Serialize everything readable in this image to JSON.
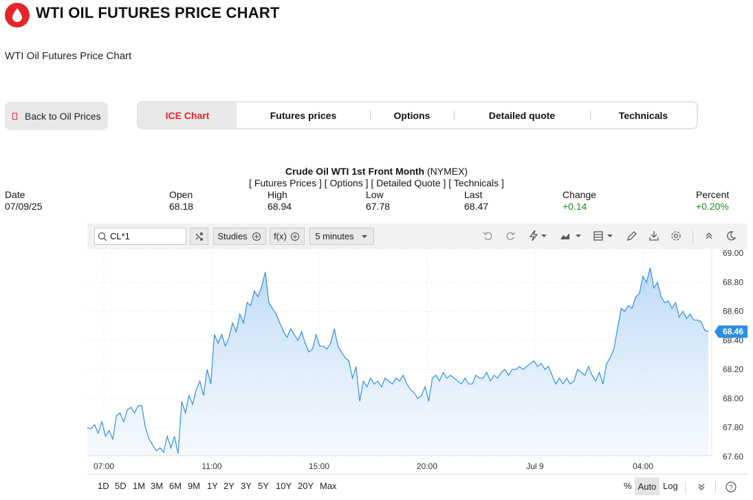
{
  "header": {
    "title": "WTI OIL FUTURES PRICE CHART",
    "subtitle": "WTI Oil Futures Price Chart",
    "logo_icon": "oil-drop-icon"
  },
  "nav": {
    "back_label": "Back to Oil Prices",
    "tabs": [
      {
        "label": "ICE Chart",
        "active": true
      },
      {
        "label": "Futures prices",
        "active": false
      },
      {
        "label": "Options",
        "active": false
      },
      {
        "label": "Detailed quote",
        "active": false
      },
      {
        "label": "Technicals",
        "active": false
      }
    ]
  },
  "quote": {
    "instrument": "Crude Oil WTI 1st Front Month",
    "exchange": "(NYMEX)",
    "links_text": "[ Futures Prices ] [ Options ] [ Detailed Quote ] [ Technicals ]",
    "labels": {
      "date": "Date",
      "open": "Open",
      "high": "High",
      "low": "Low",
      "last": "Last",
      "change": "Change",
      "percent": "Percent"
    },
    "values": {
      "date": "07/09/25",
      "open": "68.18",
      "high": "68.94",
      "low": "67.78",
      "last": "68.47",
      "change": "+0.14",
      "percent": "+0.20%"
    }
  },
  "toolbar": {
    "symbol": "CL*1",
    "studies_label": "Studies",
    "fx_label": "f(x)",
    "interval_label": "5 minutes",
    "icons": [
      "undo-icon",
      "redo-icon",
      "lightning-icon",
      "area-chart-icon",
      "layout-icon",
      "pencil-icon",
      "download-icon",
      "settings-icon",
      "collapse-up-icon",
      "dark-mode-icon"
    ]
  },
  "ranges": [
    "1D",
    "5D",
    "1M",
    "3M",
    "6M",
    "9M",
    "1Y",
    "2Y",
    "3Y",
    "5Y",
    "10Y",
    "20Y",
    "Max"
  ],
  "scale_options": {
    "percent": "%",
    "auto": "Auto",
    "log": "Log"
  },
  "colors": {
    "accent": "#e3262b",
    "line": "#2f8de4",
    "last_badge": "#2f8de4",
    "positive": "#1a8a1a"
  },
  "chart_data": {
    "type": "area",
    "series": [
      {
        "values": [
          67.8,
          67.79,
          67.82,
          67.76,
          67.84,
          67.74,
          67.78,
          67.72,
          67.88,
          67.9,
          67.84,
          67.92,
          67.94,
          67.9,
          67.95,
          67.95,
          67.8,
          67.72,
          67.68,
          67.64,
          67.66,
          67.63,
          67.74,
          67.66,
          67.74,
          67.62,
          67.98,
          67.9,
          68.02,
          67.96,
          68.06,
          68.12,
          68.02,
          68.2,
          68.1,
          68.44,
          68.38,
          68.44,
          68.36,
          68.42,
          68.52,
          68.46,
          68.58,
          68.52,
          68.66,
          68.64,
          68.74,
          68.7,
          68.77,
          68.87,
          68.66,
          68.62,
          68.58,
          68.52,
          68.46,
          68.42,
          68.48,
          68.44,
          68.4,
          68.46,
          68.38,
          68.32,
          68.34,
          68.44,
          68.36,
          68.36,
          68.34,
          68.38,
          68.48,
          68.36,
          68.32,
          68.28,
          68.26,
          68.14,
          68.22,
          67.98,
          68.12,
          68.08,
          68.14,
          68.1,
          68.12,
          68.08,
          68.14,
          68.12,
          68.1,
          68.14,
          68.12,
          68.16,
          68.1,
          68.06,
          68.04,
          68.0,
          68.02,
          68.08,
          67.98,
          68.14,
          68.16,
          68.12,
          68.18,
          68.14,
          68.16,
          68.14,
          68.12,
          68.1,
          68.14,
          68.1,
          68.1,
          68.16,
          68.14,
          68.14,
          68.18,
          68.12,
          68.16,
          68.14,
          68.18,
          68.2,
          68.16,
          68.2,
          68.2,
          68.22,
          68.2,
          68.22,
          68.24,
          68.26,
          68.22,
          68.24,
          68.2,
          68.22,
          68.16,
          68.1,
          68.14,
          68.1,
          68.14,
          68.1,
          68.12,
          68.2,
          68.18,
          68.16,
          68.22,
          68.16,
          68.12,
          68.18,
          68.1,
          68.24,
          68.28,
          68.34,
          68.48,
          68.62,
          68.6,
          68.64,
          68.62,
          68.7,
          68.72,
          68.84,
          68.8,
          68.9,
          68.76,
          68.8,
          68.7,
          68.66,
          68.67,
          68.62,
          68.66,
          68.56,
          68.6,
          68.55,
          68.58,
          68.54,
          68.54,
          68.53,
          68.47,
          68.46
        ]
      }
    ],
    "x_tick_labels": [
      "07:00",
      "11:00",
      "15:00",
      "20:00",
      "Jul 9",
      "04:00"
    ],
    "y_tick_labels": [
      "69.00",
      "68.80",
      "68.60",
      "68.40",
      "68.20",
      "68.00",
      "67.80",
      "67.60"
    ],
    "ylim": [
      67.59,
      69.01
    ],
    "last_value_label": "68.46",
    "grid": true
  }
}
